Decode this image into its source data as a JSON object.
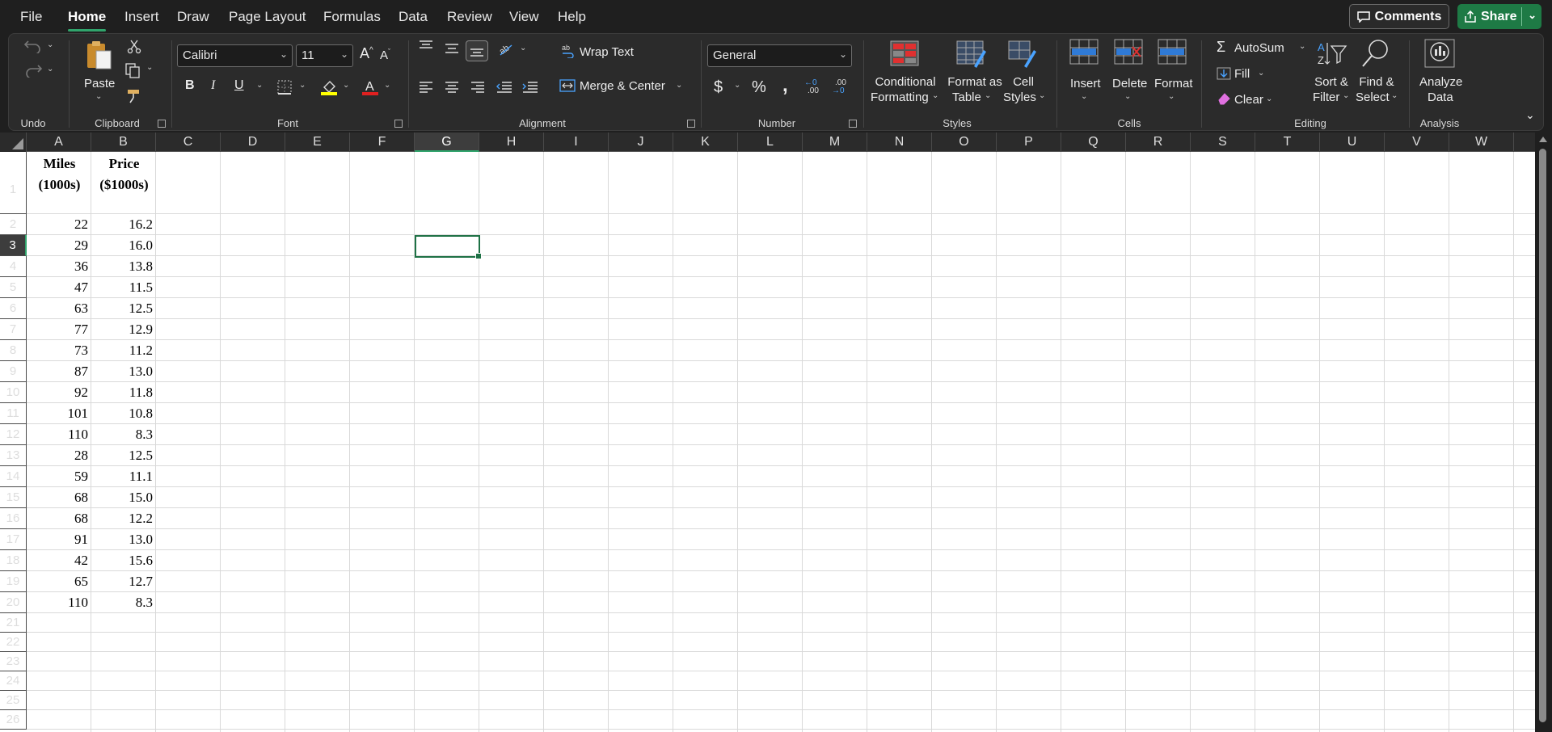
{
  "menu": {
    "items": [
      "File",
      "Home",
      "Insert",
      "Draw",
      "Page Layout",
      "Formulas",
      "Data",
      "Review",
      "View",
      "Help"
    ],
    "comments_label": "Comments",
    "share_label": "Share"
  },
  "ribbon": {
    "undo": {
      "group_label": "Undo"
    },
    "clipboard": {
      "paste_label": "Paste",
      "group_label": "Clipboard"
    },
    "font": {
      "font_name": "Calibri",
      "font_size": "11",
      "bold": "B",
      "italic": "I",
      "underline": "U",
      "group_label": "Font"
    },
    "alignment": {
      "wrap_text": "Wrap Text",
      "merge_center": "Merge & Center",
      "group_label": "Alignment"
    },
    "number": {
      "format": "General",
      "currency": "$",
      "percent": "%",
      "comma": ",",
      "inc_decimal": ".00",
      "dec_decimal": ".00",
      "group_label": "Number"
    },
    "styles": {
      "conditional_line1": "Conditional",
      "conditional_line2": "Formatting",
      "format_table_line1": "Format as",
      "format_table_line2": "Table",
      "cell_styles_line1": "Cell",
      "cell_styles_line2": "Styles",
      "group_label": "Styles"
    },
    "cells": {
      "insert": "Insert",
      "delete": "Delete",
      "format": "Format",
      "group_label": "Cells"
    },
    "editing": {
      "autosum": "AutoSum",
      "fill": "Fill",
      "clear": "Clear",
      "sort_line1": "Sort &",
      "sort_line2": "Filter",
      "find_line1": "Find &",
      "find_line2": "Select",
      "group_label": "Editing"
    },
    "analysis": {
      "line1": "Analyze",
      "line2": "Data",
      "group_label": "Analysis"
    }
  },
  "sheet": {
    "columns": [
      "A",
      "B",
      "C",
      "D",
      "E",
      "F",
      "G",
      "H",
      "I",
      "J",
      "K",
      "L",
      "M",
      "N",
      "O",
      "P",
      "Q",
      "R",
      "S",
      "T",
      "U",
      "V",
      "W"
    ],
    "selected_column": "G",
    "selected_row": 3,
    "rows": [
      "1",
      "2",
      "3",
      "4",
      "5",
      "6",
      "7",
      "8",
      "9",
      "10",
      "11",
      "12",
      "13",
      "14",
      "15",
      "16",
      "17",
      "18",
      "19",
      "20",
      "21",
      "22",
      "23",
      "24",
      "25",
      "26"
    ],
    "header_a": {
      "line1": "Miles",
      "line2": "(1000s)"
    },
    "header_b": {
      "line1": "Price",
      "line2": "($1000s)"
    },
    "data": [
      [
        "22",
        "16.2"
      ],
      [
        "29",
        "16.0"
      ],
      [
        "36",
        "13.8"
      ],
      [
        "47",
        "11.5"
      ],
      [
        "63",
        "12.5"
      ],
      [
        "77",
        "12.9"
      ],
      [
        "73",
        "11.2"
      ],
      [
        "87",
        "13.0"
      ],
      [
        "92",
        "11.8"
      ],
      [
        "101",
        "10.8"
      ],
      [
        "110",
        "8.3"
      ],
      [
        "28",
        "12.5"
      ],
      [
        "59",
        "11.1"
      ],
      [
        "68",
        "15.0"
      ],
      [
        "68",
        "12.2"
      ],
      [
        "91",
        "13.0"
      ],
      [
        "42",
        "15.6"
      ],
      [
        "65",
        "12.7"
      ],
      [
        "110",
        "8.3"
      ]
    ]
  }
}
